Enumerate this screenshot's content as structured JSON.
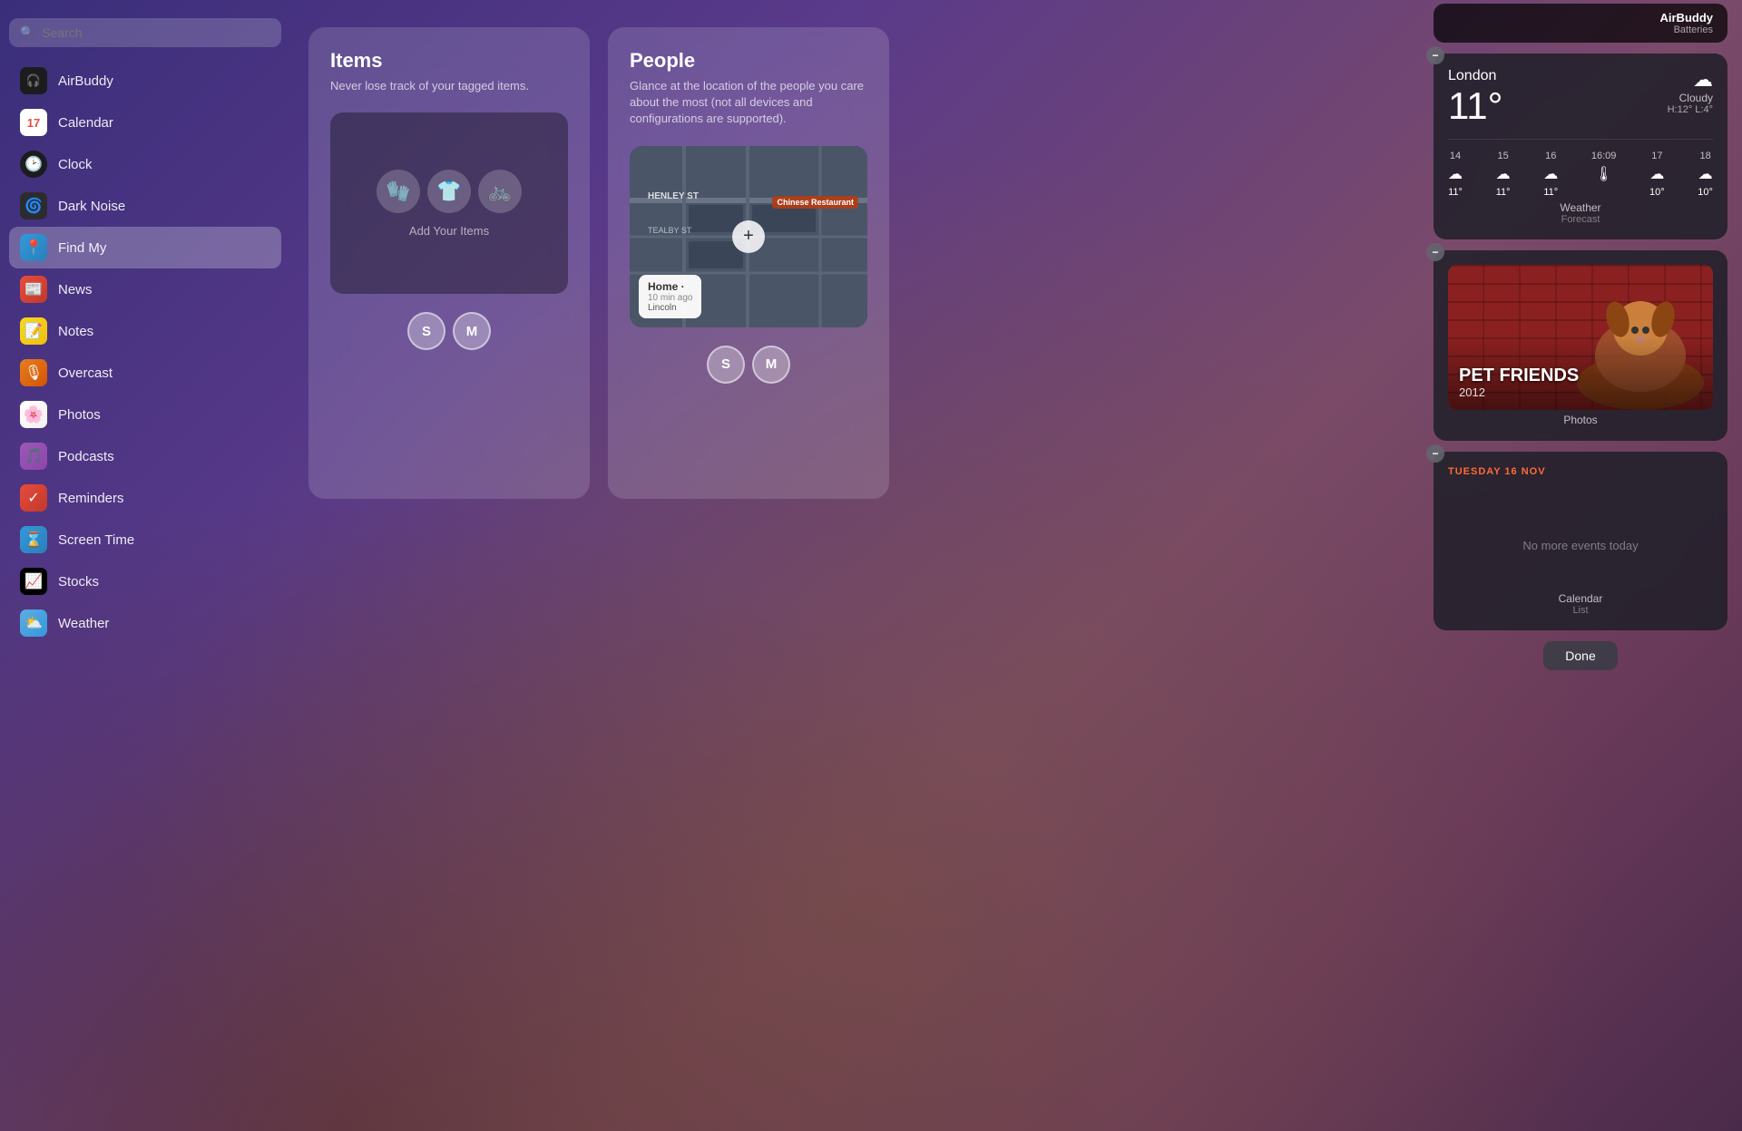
{
  "sidebar": {
    "search_placeholder": "Search",
    "items": [
      {
        "id": "airbuddy",
        "label": "AirBuddy",
        "icon": "🎧",
        "icon_class": "icon-airbuddy",
        "active": false
      },
      {
        "id": "calendar",
        "label": "Calendar",
        "icon": "17",
        "icon_class": "icon-calendar",
        "active": false
      },
      {
        "id": "clock",
        "label": "Clock",
        "icon": "🕐",
        "icon_class": "icon-clock",
        "active": false
      },
      {
        "id": "darknoise",
        "label": "Dark Noise",
        "icon": "🌊",
        "icon_class": "icon-darknoise",
        "active": false
      },
      {
        "id": "findmy",
        "label": "Find My",
        "icon": "📍",
        "icon_class": "icon-findmy",
        "active": true
      },
      {
        "id": "news",
        "label": "News",
        "icon": "📰",
        "icon_class": "icon-news",
        "active": false
      },
      {
        "id": "notes",
        "label": "Notes",
        "icon": "📝",
        "icon_class": "icon-notes",
        "active": false
      },
      {
        "id": "overcast",
        "label": "Overcast",
        "icon": "🎙",
        "icon_class": "icon-overcast",
        "active": false
      },
      {
        "id": "photos",
        "label": "Photos",
        "icon": "🌸",
        "icon_class": "icon-photos",
        "active": false
      },
      {
        "id": "podcasts",
        "label": "Podcasts",
        "icon": "🎙",
        "icon_class": "icon-podcasts",
        "active": false
      },
      {
        "id": "reminders",
        "label": "Reminders",
        "icon": "✅",
        "icon_class": "icon-reminders",
        "active": false
      },
      {
        "id": "screentime",
        "label": "Screen Time",
        "icon": "⌛",
        "icon_class": "icon-screentime",
        "active": false
      },
      {
        "id": "stocks",
        "label": "Stocks",
        "icon": "📈",
        "icon_class": "icon-stocks",
        "active": false
      },
      {
        "id": "weather",
        "label": "Weather",
        "icon": "🌤",
        "icon_class": "icon-weather",
        "active": false
      }
    ]
  },
  "items_card": {
    "title": "Items",
    "description": "Never lose track of your tagged items.",
    "add_label": "Add Your Items",
    "icons": [
      "🧤",
      "👕",
      "🚲"
    ],
    "avatars": [
      "S",
      "M"
    ]
  },
  "people_card": {
    "title": "People",
    "description": "Glance at the location of the people you care about the most (not all devices and configurations are supported).",
    "street1": "HENLEY ST",
    "street2": "TEALBY ST",
    "time_ago": "10 min ago",
    "dest_label": "Home",
    "dest_name": "Lincoln",
    "place_name": "Chinese Restaurant",
    "avatars": [
      "S",
      "M"
    ]
  },
  "airbuddy_widget": {
    "title": "AirBuddy",
    "subtitle": "Batteries"
  },
  "weather_widget": {
    "city": "London",
    "temperature": "11°",
    "condition": "Cloudy",
    "high_low": "H:12° L:4°",
    "cloud_icon": "☁",
    "forecast": [
      {
        "time": "14",
        "icon": "☁",
        "temp": "11°"
      },
      {
        "time": "15",
        "icon": "☁",
        "temp": "11°"
      },
      {
        "time": "16",
        "icon": "☁",
        "temp": "11°"
      },
      {
        "time": "16:09",
        "icon": "🌡",
        "temp": ""
      },
      {
        "time": "17",
        "icon": "☁",
        "temp": "10°"
      },
      {
        "time": "18",
        "icon": "☁",
        "temp": "10°"
      }
    ],
    "label": "Weather",
    "sublabel": "Forecast"
  },
  "photos_widget": {
    "title": "PET FRIENDS",
    "year": "2012",
    "label": "Photos"
  },
  "calendar_widget": {
    "date": "TUESDAY 16 NOV",
    "no_events": "No more events today",
    "label": "Calendar",
    "sublabel": "List"
  },
  "done_button": "Done"
}
